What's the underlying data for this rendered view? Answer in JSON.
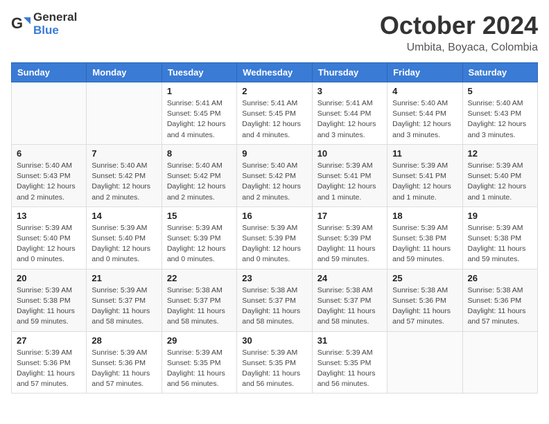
{
  "header": {
    "logo_general": "General",
    "logo_blue": "Blue",
    "month": "October 2024",
    "location": "Umbita, Boyaca, Colombia"
  },
  "weekdays": [
    "Sunday",
    "Monday",
    "Tuesday",
    "Wednesday",
    "Thursday",
    "Friday",
    "Saturday"
  ],
  "weeks": [
    [
      {
        "day": "",
        "info": ""
      },
      {
        "day": "",
        "info": ""
      },
      {
        "day": "1",
        "info": "Sunrise: 5:41 AM\nSunset: 5:45 PM\nDaylight: 12 hours and 4 minutes."
      },
      {
        "day": "2",
        "info": "Sunrise: 5:41 AM\nSunset: 5:45 PM\nDaylight: 12 hours and 4 minutes."
      },
      {
        "day": "3",
        "info": "Sunrise: 5:41 AM\nSunset: 5:44 PM\nDaylight: 12 hours and 3 minutes."
      },
      {
        "day": "4",
        "info": "Sunrise: 5:40 AM\nSunset: 5:44 PM\nDaylight: 12 hours and 3 minutes."
      },
      {
        "day": "5",
        "info": "Sunrise: 5:40 AM\nSunset: 5:43 PM\nDaylight: 12 hours and 3 minutes."
      }
    ],
    [
      {
        "day": "6",
        "info": "Sunrise: 5:40 AM\nSunset: 5:43 PM\nDaylight: 12 hours and 2 minutes."
      },
      {
        "day": "7",
        "info": "Sunrise: 5:40 AM\nSunset: 5:42 PM\nDaylight: 12 hours and 2 minutes."
      },
      {
        "day": "8",
        "info": "Sunrise: 5:40 AM\nSunset: 5:42 PM\nDaylight: 12 hours and 2 minutes."
      },
      {
        "day": "9",
        "info": "Sunrise: 5:40 AM\nSunset: 5:42 PM\nDaylight: 12 hours and 2 minutes."
      },
      {
        "day": "10",
        "info": "Sunrise: 5:39 AM\nSunset: 5:41 PM\nDaylight: 12 hours and 1 minute."
      },
      {
        "day": "11",
        "info": "Sunrise: 5:39 AM\nSunset: 5:41 PM\nDaylight: 12 hours and 1 minute."
      },
      {
        "day": "12",
        "info": "Sunrise: 5:39 AM\nSunset: 5:40 PM\nDaylight: 12 hours and 1 minute."
      }
    ],
    [
      {
        "day": "13",
        "info": "Sunrise: 5:39 AM\nSunset: 5:40 PM\nDaylight: 12 hours and 0 minutes."
      },
      {
        "day": "14",
        "info": "Sunrise: 5:39 AM\nSunset: 5:40 PM\nDaylight: 12 hours and 0 minutes."
      },
      {
        "day": "15",
        "info": "Sunrise: 5:39 AM\nSunset: 5:39 PM\nDaylight: 12 hours and 0 minutes."
      },
      {
        "day": "16",
        "info": "Sunrise: 5:39 AM\nSunset: 5:39 PM\nDaylight: 12 hours and 0 minutes."
      },
      {
        "day": "17",
        "info": "Sunrise: 5:39 AM\nSunset: 5:39 PM\nDaylight: 11 hours and 59 minutes."
      },
      {
        "day": "18",
        "info": "Sunrise: 5:39 AM\nSunset: 5:38 PM\nDaylight: 11 hours and 59 minutes."
      },
      {
        "day": "19",
        "info": "Sunrise: 5:39 AM\nSunset: 5:38 PM\nDaylight: 11 hours and 59 minutes."
      }
    ],
    [
      {
        "day": "20",
        "info": "Sunrise: 5:39 AM\nSunset: 5:38 PM\nDaylight: 11 hours and 59 minutes."
      },
      {
        "day": "21",
        "info": "Sunrise: 5:39 AM\nSunset: 5:37 PM\nDaylight: 11 hours and 58 minutes."
      },
      {
        "day": "22",
        "info": "Sunrise: 5:38 AM\nSunset: 5:37 PM\nDaylight: 11 hours and 58 minutes."
      },
      {
        "day": "23",
        "info": "Sunrise: 5:38 AM\nSunset: 5:37 PM\nDaylight: 11 hours and 58 minutes."
      },
      {
        "day": "24",
        "info": "Sunrise: 5:38 AM\nSunset: 5:37 PM\nDaylight: 11 hours and 58 minutes."
      },
      {
        "day": "25",
        "info": "Sunrise: 5:38 AM\nSunset: 5:36 PM\nDaylight: 11 hours and 57 minutes."
      },
      {
        "day": "26",
        "info": "Sunrise: 5:38 AM\nSunset: 5:36 PM\nDaylight: 11 hours and 57 minutes."
      }
    ],
    [
      {
        "day": "27",
        "info": "Sunrise: 5:39 AM\nSunset: 5:36 PM\nDaylight: 11 hours and 57 minutes."
      },
      {
        "day": "28",
        "info": "Sunrise: 5:39 AM\nSunset: 5:36 PM\nDaylight: 11 hours and 57 minutes."
      },
      {
        "day": "29",
        "info": "Sunrise: 5:39 AM\nSunset: 5:35 PM\nDaylight: 11 hours and 56 minutes."
      },
      {
        "day": "30",
        "info": "Sunrise: 5:39 AM\nSunset: 5:35 PM\nDaylight: 11 hours and 56 minutes."
      },
      {
        "day": "31",
        "info": "Sunrise: 5:39 AM\nSunset: 5:35 PM\nDaylight: 11 hours and 56 minutes."
      },
      {
        "day": "",
        "info": ""
      },
      {
        "day": "",
        "info": ""
      }
    ]
  ]
}
